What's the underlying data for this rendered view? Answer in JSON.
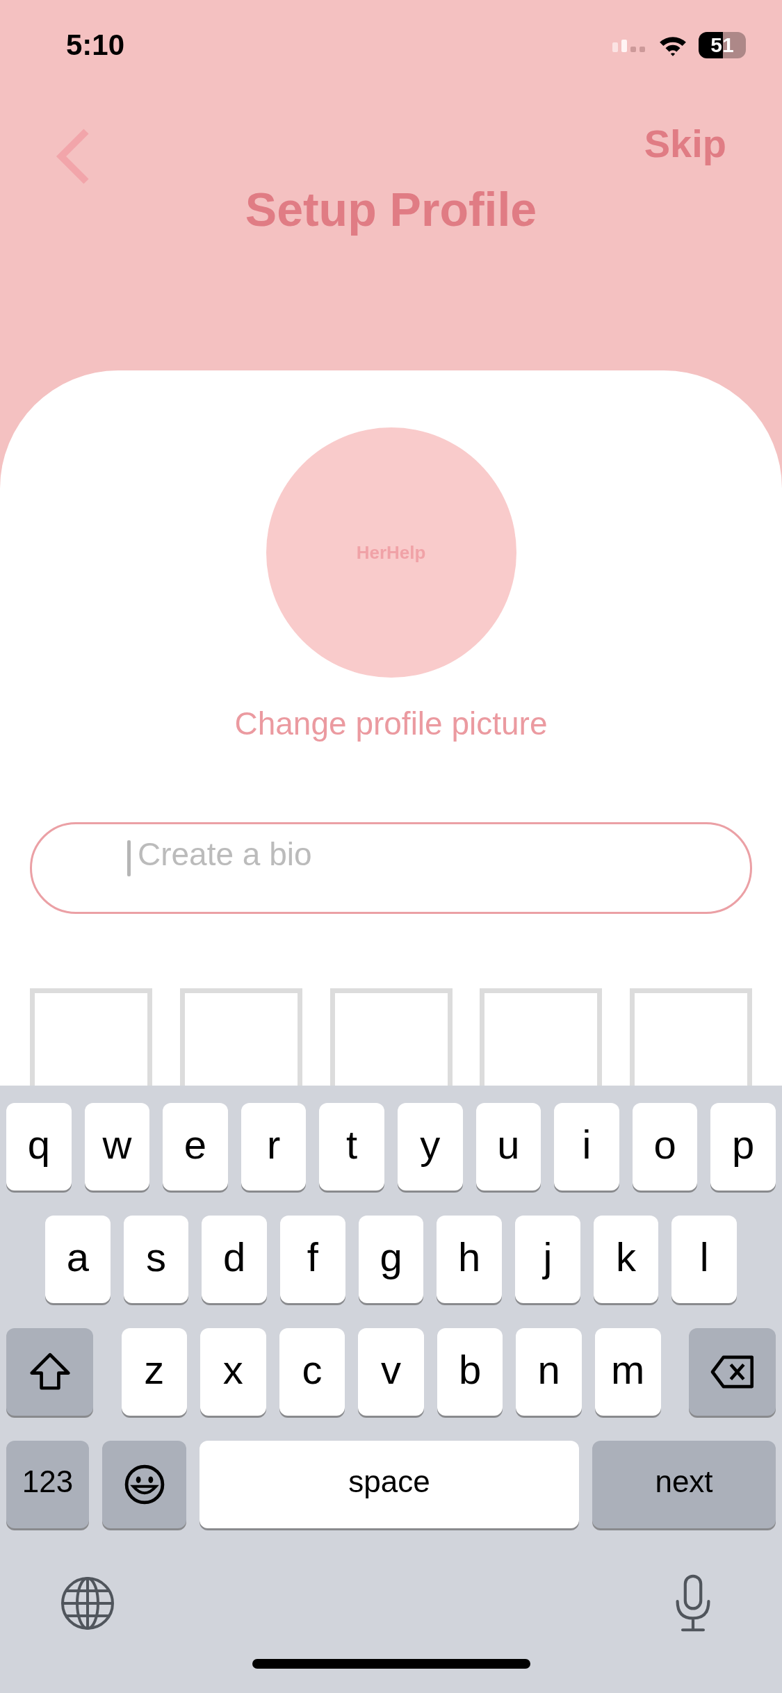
{
  "status_bar": {
    "time": "5:10",
    "battery": "51"
  },
  "header": {
    "title": "Setup Profile",
    "skip": "Skip"
  },
  "avatar": {
    "text": "HerHelp"
  },
  "change_photo_link": "Change profile picture",
  "bio_field": {
    "placeholder": "Create a bio",
    "focused": true
  },
  "photo_slots": [
    {
      "filled": false
    },
    {
      "filled": false
    },
    {
      "filled": false
    },
    {
      "filled": false
    },
    {
      "filled": false
    }
  ],
  "keyboard": {
    "rows": [
      {
        "keys": [
          {
            "kind": "letter",
            "label": "q"
          },
          {
            "kind": "letter",
            "label": "w"
          },
          {
            "kind": "letter",
            "label": "e"
          },
          {
            "kind": "letter",
            "label": "r"
          },
          {
            "kind": "letter",
            "label": "t"
          },
          {
            "kind": "letter",
            "label": "y"
          },
          {
            "kind": "letter",
            "label": "u"
          },
          {
            "kind": "letter",
            "label": "i"
          },
          {
            "kind": "letter",
            "label": "o"
          },
          {
            "kind": "letter",
            "label": "p"
          }
        ]
      },
      {
        "keys": [
          {
            "kind": "letter",
            "label": "a"
          },
          {
            "kind": "letter",
            "label": "s"
          },
          {
            "kind": "letter",
            "label": "d"
          },
          {
            "kind": "letter",
            "label": "f"
          },
          {
            "kind": "letter",
            "label": "g"
          },
          {
            "kind": "letter",
            "label": "h"
          },
          {
            "kind": "letter",
            "label": "j"
          },
          {
            "kind": "letter",
            "label": "k"
          },
          {
            "kind": "letter",
            "label": "l"
          }
        ]
      },
      {
        "keys": [
          {
            "kind": "shift"
          },
          {
            "kind": "letter",
            "label": "z"
          },
          {
            "kind": "letter",
            "label": "x"
          },
          {
            "kind": "letter",
            "label": "c"
          },
          {
            "kind": "letter",
            "label": "v"
          },
          {
            "kind": "letter",
            "label": "b"
          },
          {
            "kind": "letter",
            "label": "n"
          },
          {
            "kind": "letter",
            "label": "m"
          },
          {
            "kind": "delete"
          }
        ]
      },
      {
        "keys": [
          {
            "kind": "numbers",
            "label": "123"
          },
          {
            "kind": "emoji"
          },
          {
            "kind": "space",
            "label": "space"
          },
          {
            "kind": "return",
            "label": "next"
          }
        ]
      }
    ]
  }
}
